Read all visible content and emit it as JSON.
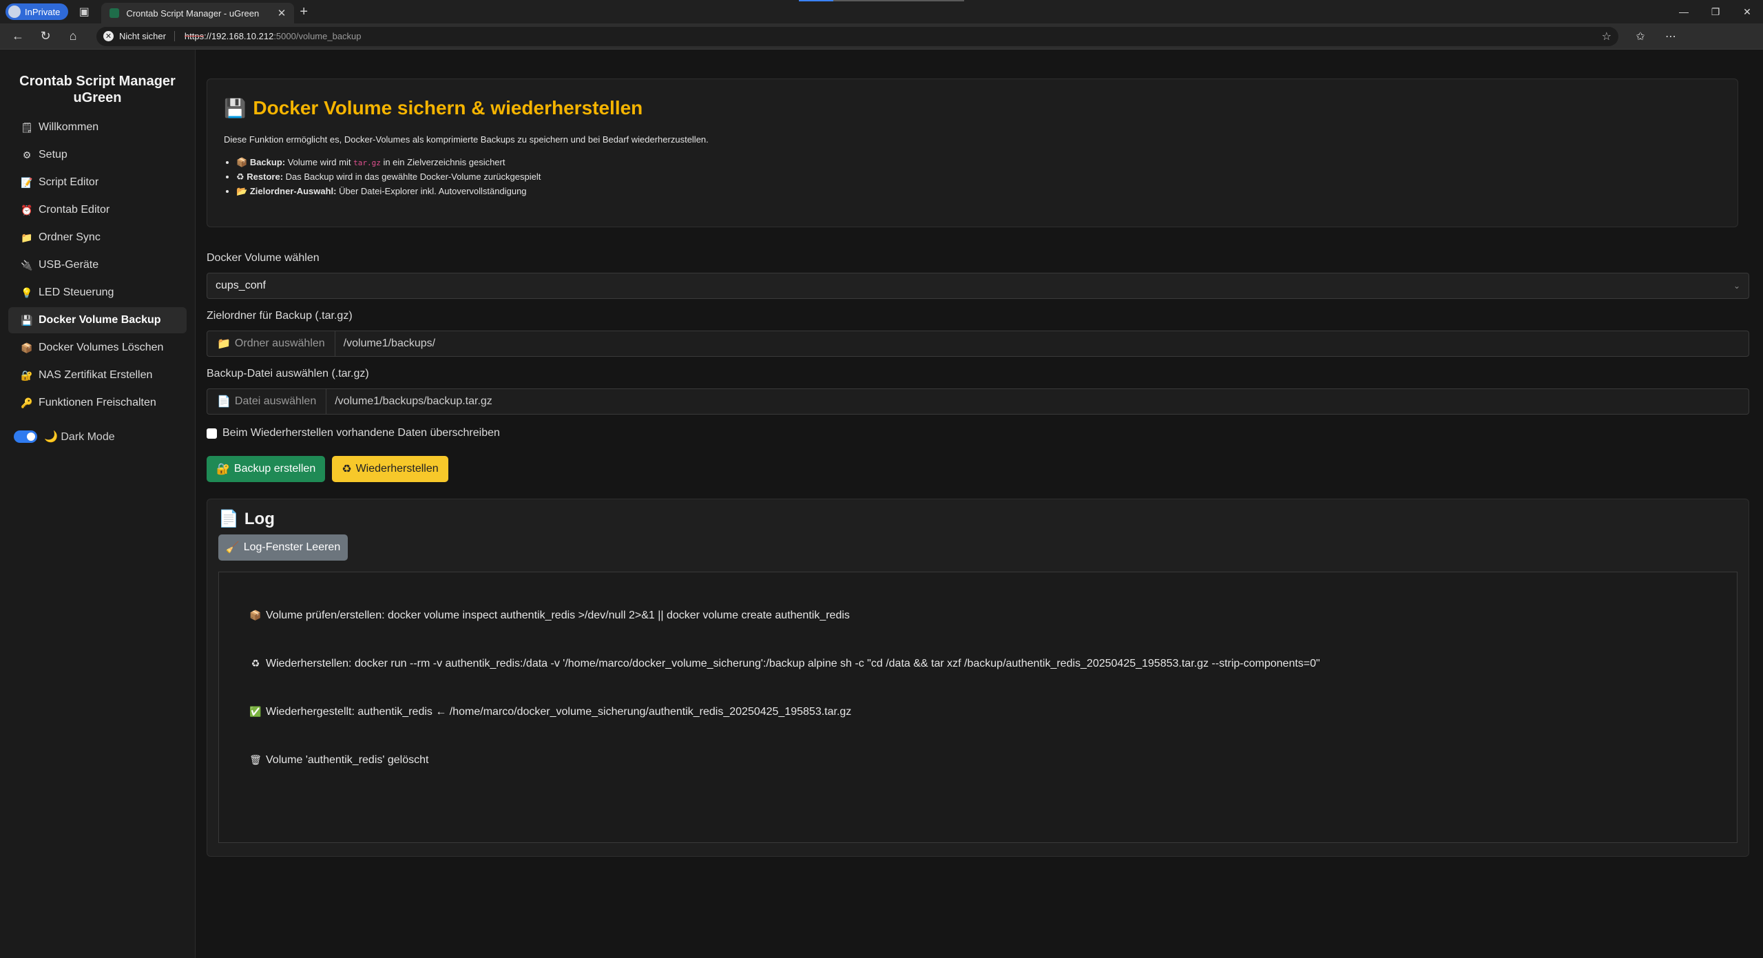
{
  "browser": {
    "profile_label": "InPrivate",
    "tab_title": "Crontab Script Manager - uGreen",
    "security_label": "Nicht sicher",
    "url_scheme": "https",
    "url_host": "://192.168.10.212",
    "url_path": ":5000/volume_backup"
  },
  "sidebar": {
    "brand": "Crontab Script Manager uGreen",
    "items": [
      {
        "icon": "🗒",
        "label": "Willkommen"
      },
      {
        "icon": "⚙",
        "label": "Setup"
      },
      {
        "icon": "📝",
        "label": "Script Editor"
      },
      {
        "icon": "⏰",
        "label": "Crontab Editor"
      },
      {
        "icon": "📁",
        "label": "Ordner Sync"
      },
      {
        "icon": "🔌",
        "label": "USB-Geräte"
      },
      {
        "icon": "💡",
        "label": "LED Steuerung"
      },
      {
        "icon": "💾",
        "label": "Docker Volume Backup"
      },
      {
        "icon": "📦",
        "label": "Docker Volumes Löschen"
      },
      {
        "icon": "🔐",
        "label": "NAS Zertifikat Erstellen"
      },
      {
        "icon": "🔑",
        "label": "Funktionen Freischalten"
      }
    ],
    "dark_mode_label": "🌙 Dark Mode"
  },
  "info": {
    "title": "Docker Volume sichern & wiederherstellen",
    "description": "Diese Funktion ermöglicht es, Docker-Volumes als komprimierte Backups zu speichern und bei Bedarf wiederherzustellen.",
    "bullets": [
      {
        "icon": "📦",
        "strong": "Backup:",
        "pre": " Volume wird mit ",
        "code": "tar.gz",
        "post": " in ein Zielverzeichnis gesichert"
      },
      {
        "icon": "♻",
        "strong": "Restore:",
        "pre": " Das Backup wird in das gewählte Docker-Volume zurückgespielt",
        "code": "",
        "post": ""
      },
      {
        "icon": "📂",
        "strong": "Zielordner-Auswahl:",
        "pre": " Über Datei-Explorer inkl. Autovervollständigung",
        "code": "",
        "post": ""
      }
    ]
  },
  "form": {
    "volume_label": "Docker Volume wählen",
    "volume_value": "cups_conf",
    "target_label": "Zielordner für Backup (.tar.gz)",
    "target_button": "Ordner auswählen",
    "target_value": "/volume1/backups/",
    "file_label": "Backup-Datei auswählen (.tar.gz)",
    "file_button": "Datei auswählen",
    "file_value": "/volume1/backups/backup.tar.gz",
    "overwrite_label": "Beim Wiederherstellen vorhandene Daten überschreiben",
    "backup_button": "Backup erstellen",
    "restore_button": "Wiederherstellen"
  },
  "log": {
    "title": "Log",
    "clear_button": "Log-Fenster Leeren",
    "lines": [
      {
        "icon": "📦",
        "text": "Volume prüfen/erstellen: docker volume inspect authentik_redis >/dev/null 2>&1 || docker volume create authentik_redis"
      },
      {
        "icon": "♻",
        "text": "Wiederherstellen: docker run --rm -v authentik_redis:/data -v '/home/marco/docker_volume_sicherung':/backup alpine sh -c \"cd /data && tar xzf /backup/authentik_redis_20250425_195853.tar.gz --strip-components=0\""
      },
      {
        "icon": "✅",
        "text": "Wiederhergestellt: authentik_redis ← /home/marco/docker_volume_sicherung/authentik_redis_20250425_195853.tar.gz"
      },
      {
        "icon": "🗑",
        "text": "Volume 'authentik_redis' gelöscht"
      }
    ]
  }
}
